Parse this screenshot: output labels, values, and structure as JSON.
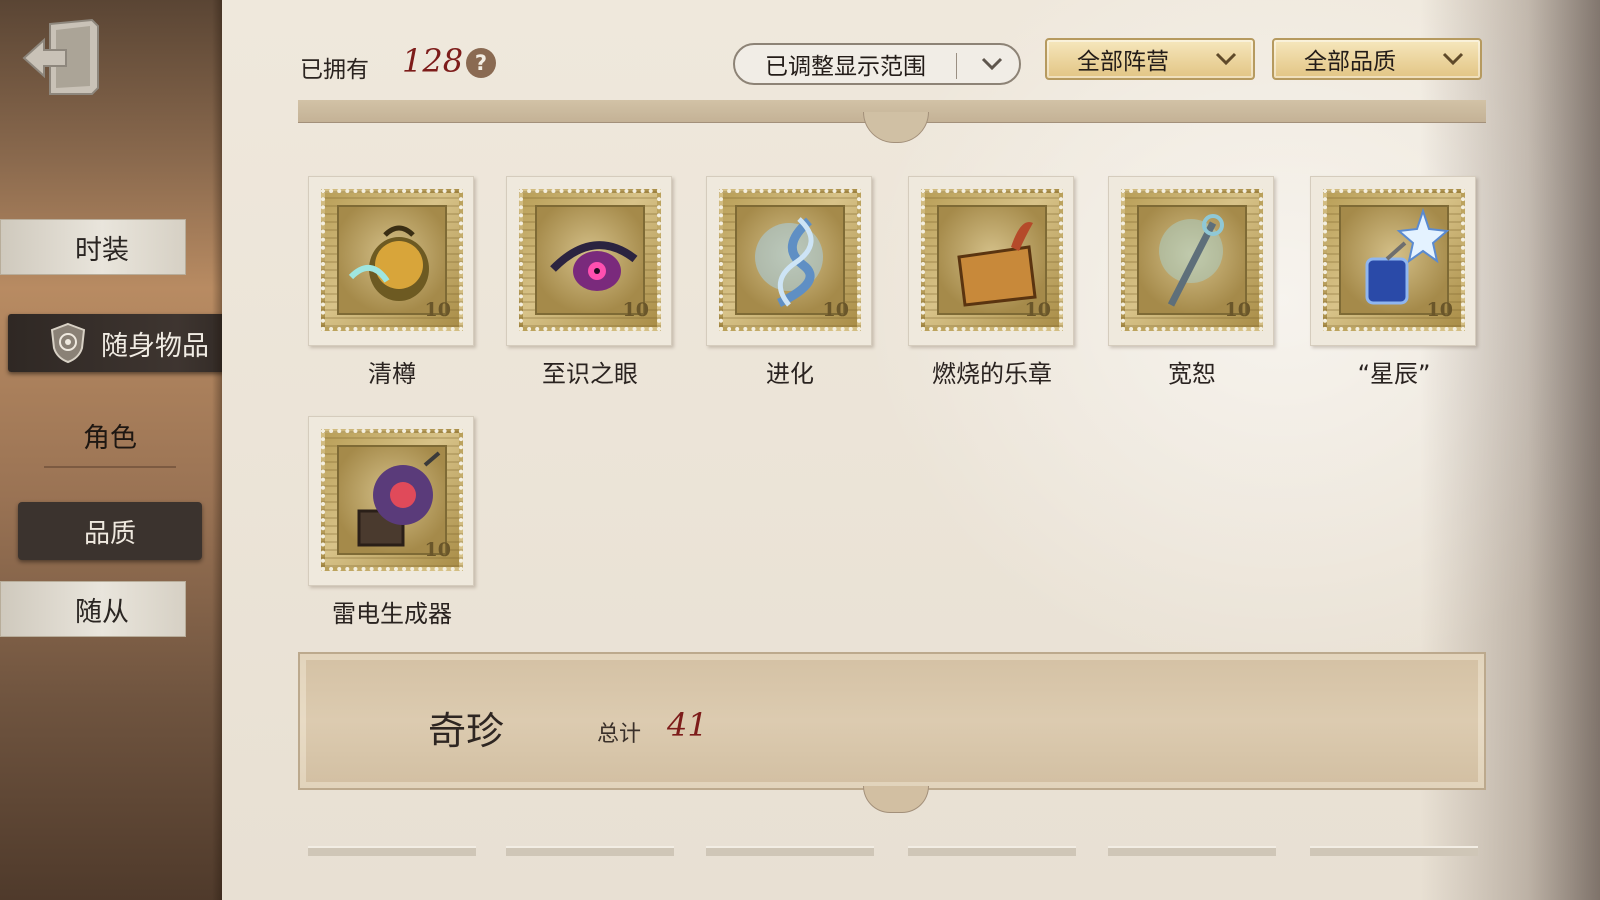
{
  "sidebar": {
    "items": [
      {
        "label": "时装"
      },
      {
        "label": "随身物品"
      },
      {
        "label": "角色"
      },
      {
        "label": "品质"
      },
      {
        "label": "随从"
      }
    ]
  },
  "header": {
    "owned_label": "已拥有",
    "owned_count": "128",
    "help": "?",
    "range_dropdown": "已调整显示范围",
    "faction_dropdown": "全部阵营",
    "quality_dropdown": "全部品质"
  },
  "items": [
    {
      "label": "清樽",
      "value": "10"
    },
    {
      "label": "至识之眼",
      "value": "10"
    },
    {
      "label": "进化",
      "value": "10"
    },
    {
      "label": "燃烧的乐章",
      "value": "10"
    },
    {
      "label": "宽恕",
      "value": "10"
    },
    {
      "label": "“星辰”",
      "value": "10"
    },
    {
      "label": "雷电生成器",
      "value": "10"
    }
  ],
  "category": {
    "title": "奇珍",
    "total_label": "总计",
    "total_value": "41"
  },
  "colors": {
    "accent_red": "#7d1c1a",
    "gold_dropdown": "#ead29a",
    "sidebar_dark": "#3b332e"
  }
}
